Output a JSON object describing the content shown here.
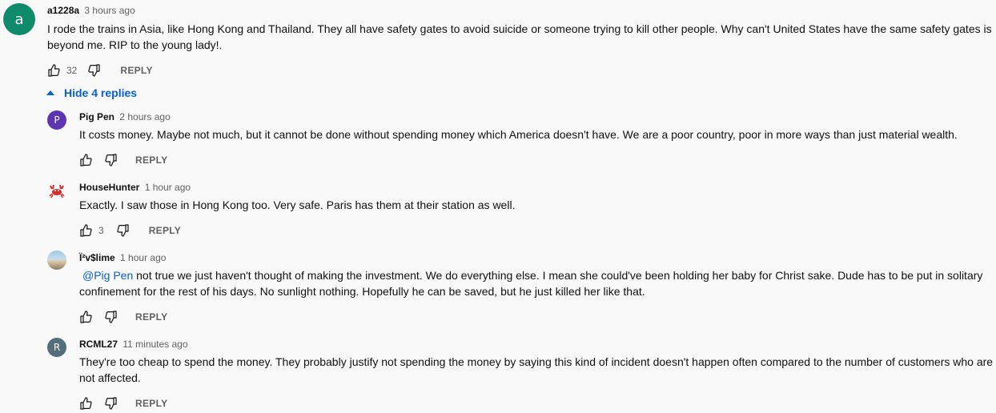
{
  "top_comment": {
    "avatar_letter": "a",
    "avatar_color": "#0f8a6b",
    "author": "a1228a",
    "time": "3 hours ago",
    "text": "I rode the trains in Asia, like Hong Kong and Thailand.  They all have safety gates to avoid suicide or someone trying to kill other people.  Why can't United States have the same safety gates is beyond me.  RIP to the young lady!.",
    "likes": "32",
    "reply_label": "REPLY"
  },
  "hide_replies_label": "Hide 4 replies",
  "replies": [
    {
      "avatar_letter": "P",
      "avatar_color": "#5e35b1",
      "author": "Pig Pen",
      "time": "2 hours ago",
      "text": "It costs money.  Maybe not much, but it cannot be done without spending money which America doesn't have.  We are a poor country, poor in more ways than just material wealth.",
      "likes": "",
      "reply_label": "REPLY"
    },
    {
      "avatar_icon": "crab-icon",
      "author": "HouseHunter",
      "time": "1 hour ago",
      "text": "Exactly. I saw those in Hong Kong too. Very safe. Paris has them at their station as well.",
      "likes": "3",
      "reply_label": "REPLY"
    },
    {
      "avatar_icon": "photo-avatar",
      "author": "Ï²v$lime",
      "time": "1 hour ago",
      "mention": "@Pig Pen",
      "text": " not true we just haven't thought of making the investment. We do everything else. I mean she could've been holding her baby for Christ sake. Dude has to be put in solitary confinement for the rest of his days. No sunlight nothing. Hopefully he can be saved, but he just killed her like that.",
      "likes": "",
      "reply_label": "REPLY"
    },
    {
      "avatar_letter": "R",
      "avatar_color": "#546e7a",
      "author": "RCML27",
      "time": "11 minutes ago",
      "text": "They're too cheap to spend the money.  They probably justify not spending the money by saying this kind of incident doesn't happen often compared to the number of customers who are not affected.",
      "likes": "",
      "reply_label": "REPLY"
    }
  ]
}
